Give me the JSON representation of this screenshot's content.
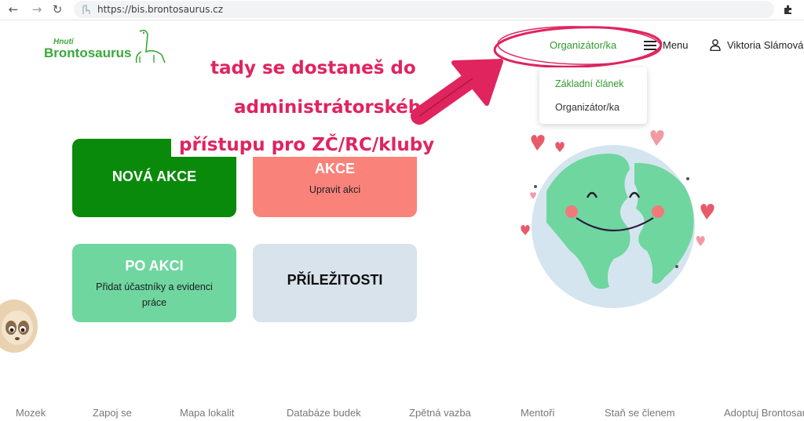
{
  "browser": {
    "back_icon": "arrow-left-icon",
    "forward_icon": "arrow-right-icon",
    "reload_icon": "reload-icon",
    "url": "https://bis.brontosaurus.cz",
    "extension_icon": "puzzle-icon"
  },
  "header": {
    "logo_small": "Hnutí",
    "logo_big": "Brontosaurus",
    "organizer_link": "Organizátor/ka",
    "menu_label": "Menu",
    "user_name": "Viktoria Slámová"
  },
  "dropdown": {
    "items": [
      {
        "label": "Základní článek",
        "active": true
      },
      {
        "label": "Organizátor/ka",
        "active": false
      }
    ]
  },
  "annotation": {
    "lines": [
      "tady se dostaneš do",
      "administrátorského",
      "přístupu pro ZČ/RC/kluby"
    ],
    "color": "#e0245e"
  },
  "cards": {
    "new_event": {
      "title": "NOVÁ AKCE"
    },
    "edit_event": {
      "title": "AKCE",
      "subtitle": "Upravit akci"
    },
    "after_event": {
      "title": "PO AKCI",
      "subtitle": "Přidat účastníky a evidenci práce"
    },
    "opportunities": {
      "title": "PŘÍLEŽITOSTI"
    }
  },
  "footer": {
    "items": [
      "Mozek",
      "Zapoj se",
      "Mapa lokalit",
      "Databáze budek",
      "Zpětná vazba",
      "Mentoři",
      "Staň se členem",
      "Adoptuj Brontosaura"
    ]
  },
  "colors": {
    "brand_green": "#3aa83a",
    "dark_green": "#0a8a0a",
    "salmon": "#f9837a",
    "mint": "#6fd6a0",
    "light_blue": "#d9e3ec",
    "annotation_pink": "#e0245e"
  }
}
